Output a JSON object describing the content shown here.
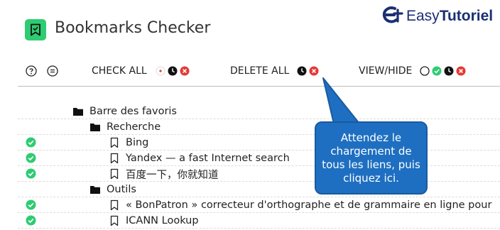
{
  "header": {
    "title": "Bookmarks Checker",
    "brand_text_light": "Easy",
    "brand_text_bold": "Tutoriel"
  },
  "toolbar": {
    "help_icon": "question-circle-icon",
    "menu_icon": "equals-circle-icon",
    "check_all_label": "CHECK ALL",
    "delete_all_label": "DELETE ALL",
    "view_hide_label": "VIEW/HIDE"
  },
  "colors": {
    "accent_green": "#2ecc71",
    "ok_green": "#2ecc71",
    "error_red": "#e53935",
    "callout_blue": "#1e6fc1",
    "brand_navy": "#1a2f74"
  },
  "tree": [
    {
      "type": "folder",
      "label": "Barre des favoris",
      "status": null,
      "icon": "folder-icon"
    },
    {
      "type": "folder",
      "label": "Recherche",
      "status": null,
      "icon": "folder-icon"
    },
    {
      "type": "bookmark",
      "label": "Bing",
      "status": "ok",
      "icon": "bookmark-icon"
    },
    {
      "type": "bookmark",
      "label": "Yandex — a fast Internet search",
      "status": "ok",
      "icon": "bookmark-icon"
    },
    {
      "type": "bookmark",
      "label": "百度一下，你就知道",
      "status": "ok",
      "icon": "bookmark-icon"
    },
    {
      "type": "folder",
      "label": "Outils",
      "status": null,
      "icon": "folder-icon"
    },
    {
      "type": "bookmark",
      "label": "« BonPatron » correcteur d'orthographe et de grammaire en ligne pour",
      "status": "ok",
      "icon": "bookmark-icon"
    },
    {
      "type": "bookmark",
      "label": "ICANN Lookup",
      "status": "ok",
      "icon": "bookmark-icon"
    }
  ],
  "callout": {
    "text": "Attendez le chargement de tous les liens, puis cliquez ici."
  }
}
